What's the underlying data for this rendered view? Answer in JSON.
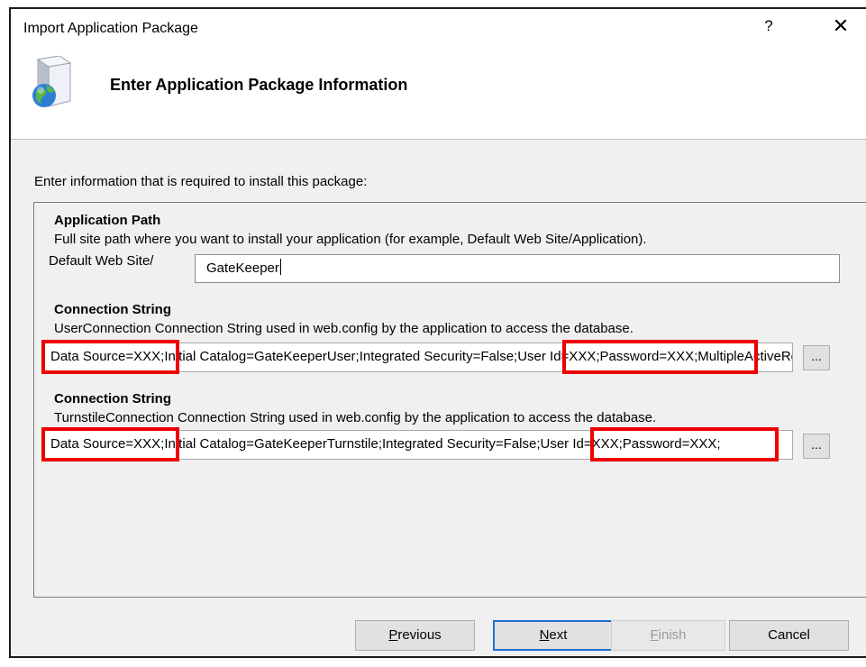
{
  "window": {
    "title": "Import Application Package",
    "help_glyph": "?",
    "close_glyph": "✕"
  },
  "header": {
    "title": "Enter Application Package Information",
    "icon": "package-globe-icon"
  },
  "intro": "Enter information that is required to install this package:",
  "application_path": {
    "title": "Application Path",
    "description": "Full site path where you want to install your application (for example, Default Web Site/Application).",
    "prefix_label": "Default Web Site/",
    "value": "GateKeeper"
  },
  "connection_strings": [
    {
      "title": "Connection String",
      "description": "UserConnection Connection String used in web.config by the application to access the database.",
      "value": "Data Source=XXX;Initial Catalog=GateKeeperUser;Integrated Security=False;User Id=XXX;Password=XXX;MultipleActiveResultSets=True",
      "browse_label": "..."
    },
    {
      "title": "Connection String",
      "description": "TurnstileConnection Connection String used in web.config by the application to access the database.",
      "value": "Data Source=XXX;Initial Catalog=GateKeeperTurnstile;Integrated Security=False;User Id=XXX;Password=XXX;",
      "browse_label": "..."
    }
  ],
  "buttons": {
    "previous": {
      "first": "P",
      "rest": "revious"
    },
    "next": {
      "first": "N",
      "rest": "ext"
    },
    "finish": {
      "first": "F",
      "rest": "inish"
    },
    "cancel": "Cancel"
  },
  "colors": {
    "highlight": "#ee0000",
    "default_button_border": "#1f6fd1",
    "dialog_background": "#f0f0f0"
  }
}
